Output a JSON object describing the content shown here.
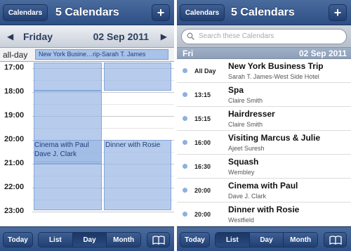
{
  "left": {
    "nav": {
      "calendars_button": "Calendars",
      "title": "5 Calendars",
      "add_button": "+"
    },
    "date_bar": {
      "prev": "◀",
      "day": "Friday",
      "date": "02 Sep 2011",
      "next": "▶"
    },
    "all_day": {
      "label": "all-day",
      "event": "New York Busine…rip-Sarah T. James"
    },
    "hours": [
      "17:00",
      "18:00",
      "19:00",
      "20:00",
      "21:00",
      "22:00",
      "23:00"
    ],
    "events": [
      {
        "title": "Cinema with Paul",
        "person": "Dave J. Clark"
      },
      {
        "title": "Dinner with Rosie"
      }
    ],
    "toolbar": {
      "today": "Today",
      "segments": [
        "List",
        "Day",
        "Month"
      ],
      "selected": "Day",
      "book_icon": "book-icon"
    }
  },
  "right": {
    "nav": {
      "calendars_button": "Calendars",
      "title": "5 Calendars",
      "add_button": "+"
    },
    "search": {
      "placeholder": "Search these Calendars"
    },
    "section": {
      "day": "Fri",
      "date": "02 Sep 2011"
    },
    "events": [
      {
        "time": "All Day",
        "title": "New York Business Trip",
        "sub": "Sarah T. James-West Side Hotel"
      },
      {
        "time": "13:15",
        "title": "Spa",
        "sub": "Claire Smith"
      },
      {
        "time": "15:15",
        "title": "Hairdresser",
        "sub": "Claire Smith"
      },
      {
        "time": "16:00",
        "title": "Visiting Marcus &  Julie",
        "sub": "Ajeet Suresh"
      },
      {
        "time": "16:30",
        "title": "Squash",
        "sub": "Wembley"
      },
      {
        "time": "20:00",
        "title": "Cinema with Paul",
        "sub": "Dave J. Clark"
      },
      {
        "time": "20:00",
        "title": "Dinner with Rosie",
        "sub": "Westfield"
      }
    ],
    "toolbar": {
      "today": "Today",
      "segments": [
        "List",
        "Day",
        "Month"
      ],
      "selected": "List",
      "book_icon": "book-icon"
    }
  },
  "colors": {
    "navbar": "#2d4f85",
    "event_fill": "#98b6e4",
    "event_dot": "#8fb0de",
    "section": "#8d9fb8"
  }
}
